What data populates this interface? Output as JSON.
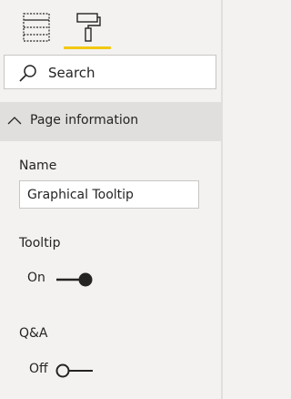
{
  "tabs": [
    {
      "name": "fields",
      "icon": "table-grid-icon",
      "active": false
    },
    {
      "name": "format",
      "icon": "paint-roller-icon",
      "active": true
    }
  ],
  "accent_color": "#f2c811",
  "search": {
    "placeholder": "Search"
  },
  "section": {
    "title": "Page information",
    "expanded": true
  },
  "fields": {
    "name_label": "Name",
    "name_value": "Graphical Tooltip",
    "tooltip_label": "Tooltip",
    "tooltip_state": "On",
    "qa_label": "Q&A",
    "qa_state": "Off"
  }
}
